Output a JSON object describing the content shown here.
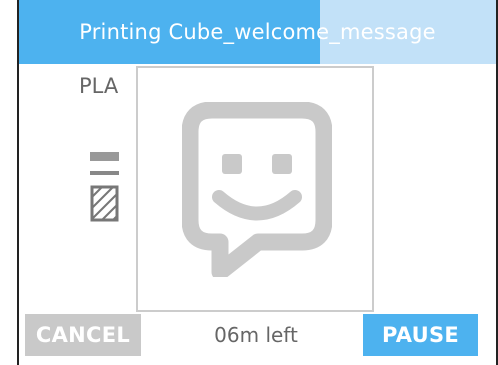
{
  "header": {
    "title": "Printing Cube_welcome_message",
    "progress_percent": 63,
    "accent_color": "#4db2ef",
    "track_color": "#c2e1f8"
  },
  "material": {
    "label": "PLA",
    "infill_icon": "infill-pattern-icon"
  },
  "preview": {
    "icon": "smiley-speech-bubble-icon"
  },
  "footer": {
    "cancel_label": "CANCEL",
    "time_left": "06m left",
    "pause_label": "PAUSE"
  }
}
